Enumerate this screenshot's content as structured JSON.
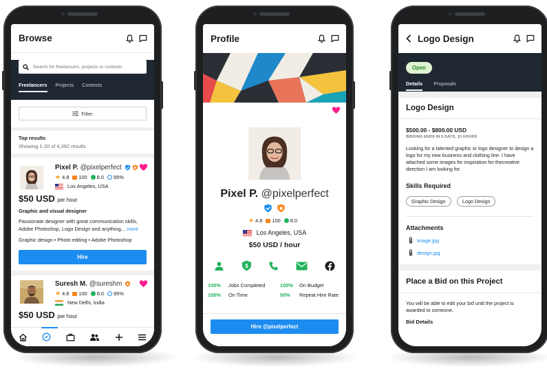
{
  "colors": {
    "accent": "#1c8cf0",
    "dark_band": "#1f2733",
    "heart": "#ff1d8e",
    "star": "#f7a11a",
    "flag_red": "#e23b3b",
    "green": "#21b25a"
  },
  "browse": {
    "title": "Browse",
    "search_placeholder": "Search for freelancers, projects or contests",
    "tabs": [
      "Freelancers",
      "Projects",
      "Contests"
    ],
    "filter_label": "Filter",
    "results_title": "Top results",
    "results_count": "Showing 1-20 of 4,392 results",
    "card1": {
      "name": "Pixel P.",
      "handle": "@pixelperfect",
      "rating": "4.8",
      "reviews": "100",
      "score": "8.0",
      "completion": "95%",
      "location": "Los Angeles, USA",
      "price": "$50 USD",
      "price_unit": "per hour",
      "headline": "Graphic and visual designer",
      "description": "Passionate designer with great communication skills, Adobe Photoshop, Logo Design and anything...",
      "more": "more",
      "skills": "Graphic design • Photo editing • Adobe Photoshop",
      "hire": "Hire"
    },
    "card2": {
      "name": "Suresh M.",
      "handle": "@sureshm",
      "rating": "4.8",
      "reviews": "100",
      "score": "8.0",
      "completion": "95%",
      "location": "New Delhi, India",
      "price": "$50 USD",
      "price_unit": "per hour"
    },
    "nav_icons": [
      "home-icon",
      "compass-icon",
      "briefcase-icon",
      "people-icon",
      "plus-icon",
      "menu-icon"
    ]
  },
  "profile": {
    "title": "Profile",
    "name": "Pixel P.",
    "handle": "@pixelperfect",
    "rating": "4.8",
    "reviews": "100",
    "score": "8.0",
    "location": "Los Angeles, USA",
    "rate": "$50 USD / hour",
    "stats": [
      {
        "pct": "100%",
        "label": "Jobs Completed"
      },
      {
        "pct": "100%",
        "label": "On Budget"
      },
      {
        "pct": "100%",
        "label": "On Time"
      },
      {
        "pct": "50%",
        "label": "Repeat Hire Rate"
      }
    ],
    "hire_button": "Hire @pixelperfect"
  },
  "project": {
    "title": "Logo Design",
    "status": "Open",
    "tabs": [
      "Details",
      "Proposals"
    ],
    "heading": "Logo Design",
    "budget": "$500.00 - $800.00 USD",
    "bidding_ends": "BIDDING ENDS IN 5 DAYS, 10 HOURS",
    "description": "Looking for a talented graphic or logo designer to design a logo for my new business and clothing line. I have attached some images for inspiration for thecreative direction I am looking for.",
    "skills_title": "Skills Required",
    "skills": [
      "Graphic Design",
      "Logo Design"
    ],
    "attachments_title": "Attachments",
    "attachments": [
      "image.jpg",
      "design.jpg"
    ],
    "bid_title": "Place a Bid on this Project",
    "bid_note": "You will be able to edit your bid until the project is awarded to someone.",
    "bid_details": "Bid Details"
  }
}
